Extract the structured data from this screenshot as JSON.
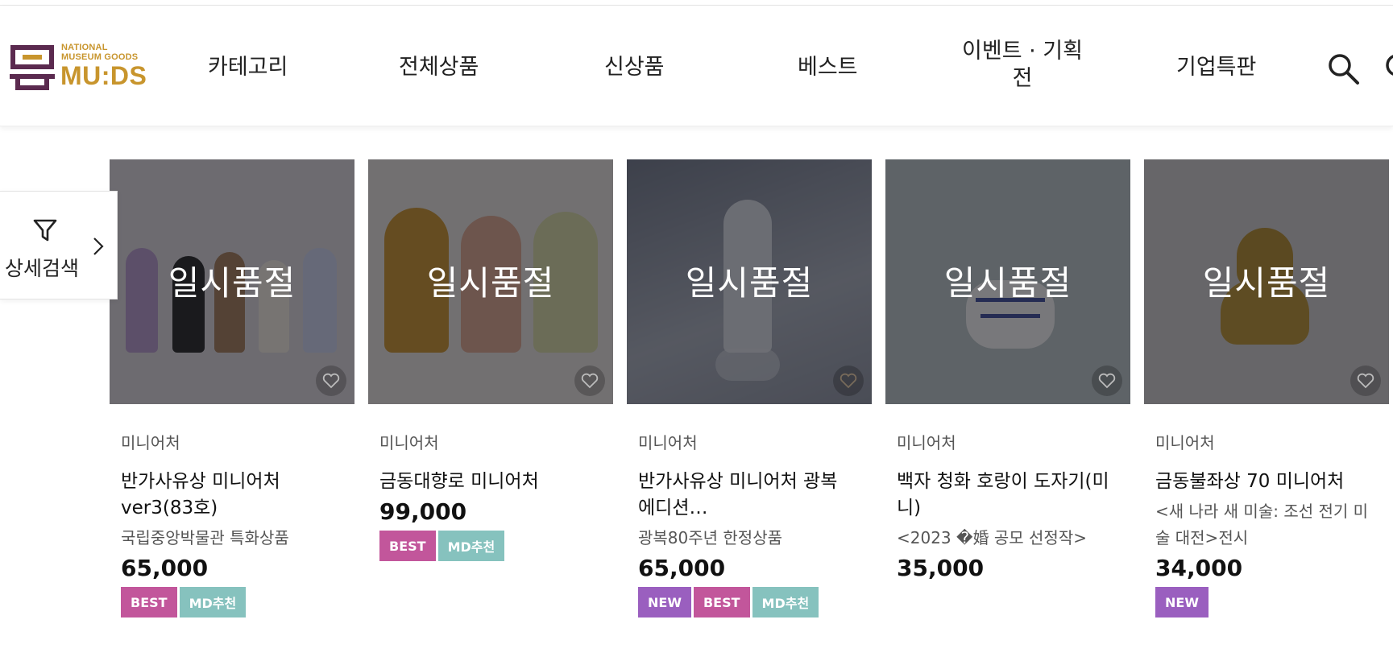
{
  "brand": {
    "line1": "NATIONAL",
    "line2": "MUSEUM GOODS",
    "wordmark": "MU:DS",
    "color": "#c8952d",
    "mark_color": "#5b2a4f"
  },
  "nav": {
    "items": [
      "카테고리",
      "전체상품",
      "신상품",
      "베스트",
      "이벤트 · 기획전",
      "기업특판"
    ],
    "event_line1": "이벤트 · 기획",
    "event_line2": "전"
  },
  "filter": {
    "label": "상세검색",
    "icon": "funnel-icon"
  },
  "soldout_label": "일시품절",
  "badge_colors": {
    "BEST": "#c2569b",
    "MD추천": "#86c2be",
    "NEW": "#9a5fbf"
  },
  "products": [
    {
      "category": "미니어처",
      "name_line1": "반가사유상 미니어처",
      "name_line2": "ver3(83호)",
      "subtitle_line1": "국립중앙박물관 특화상품",
      "subtitle_line2": "",
      "price": "65,000",
      "badges": [
        "BEST",
        "MD추천"
      ]
    },
    {
      "category": "미니어처",
      "name_line1": "금동대향로 미니어처",
      "name_line2": "",
      "subtitle_line1": "",
      "subtitle_line2": "",
      "price": "99,000",
      "badges": [
        "BEST",
        "MD추천"
      ]
    },
    {
      "category": "미니어처",
      "name_line1": "반가사유상 미니어처 광복",
      "name_line2": "에디션…",
      "subtitle_line1": "광복80주년 한정상품",
      "subtitle_line2": "",
      "price": "65,000",
      "badges": [
        "NEW",
        "BEST",
        "MD추천"
      ]
    },
    {
      "category": "미니어처",
      "name_line1": "백자 청화 호랑이 도자기(미",
      "name_line2": "니)",
      "subtitle_line1": "<2023 �婚 공모 선정작>",
      "subtitle_line2": "",
      "price": "35,000",
      "badges": []
    },
    {
      "category": "미니어처",
      "name_line1": "금동불좌상 70 미니어처",
      "name_line2": "",
      "subtitle_line1": "<새 나라 새 미술: 조선 전기 미",
      "subtitle_line2": "술 대전>전시",
      "price": "34,000",
      "badges": [
        "NEW"
      ]
    }
  ]
}
